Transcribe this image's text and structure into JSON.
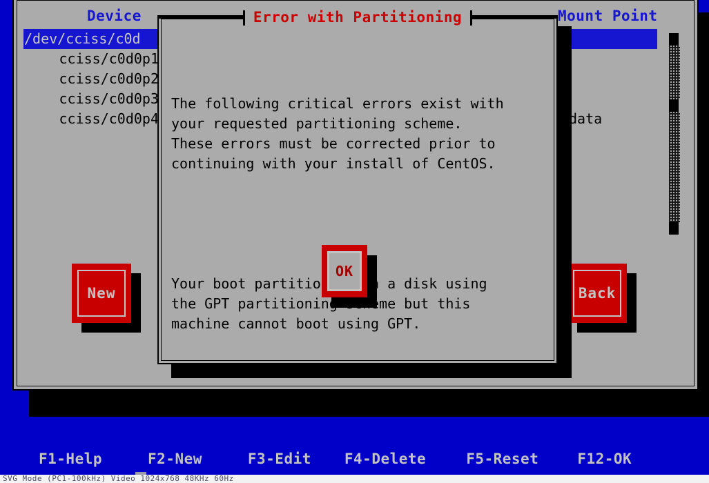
{
  "screen": {
    "background_color": "#0000c8",
    "window_face_color": "#ababab",
    "accent_blue": "#1616d0",
    "button_red": "#c80000",
    "title_red": "#cc0000",
    "label_gray": "#c3c3c3"
  },
  "main_window": {
    "columns": {
      "device_header": "Device",
      "mount_point_header": "Mount Point"
    },
    "devices": [
      {
        "label": "/dev/cciss/c0d",
        "selected": true
      },
      {
        "label": "cciss/c0d0p1",
        "selected": false
      },
      {
        "label": "cciss/c0d0p2",
        "selected": false
      },
      {
        "label": "cciss/c0d0p3",
        "selected": false
      },
      {
        "label": "cciss/c0d0p4",
        "selected": false
      }
    ],
    "mount_points": [
      {
        "label": "",
        "selected": true
      },
      {
        "label": "",
        "selected": false
      },
      {
        "label": "",
        "selected": false
      },
      {
        "label": "",
        "selected": false
      },
      {
        "label": "data",
        "selected": false
      }
    ],
    "buttons": {
      "new_label": "New",
      "back_label": "Back"
    },
    "scrollbar": {
      "up_arrow_icon": "scroll-up-arrow-icon",
      "down_arrow_icon": "scroll-down-arrow-icon",
      "thumb_icon": "scroll-thumb-icon"
    }
  },
  "dialog": {
    "title": "Error with Partitioning",
    "paragraph_1": "The following critical errors exist with\nyour requested partitioning scheme.\nThese errors must be corrected prior to\ncontinuing with your install of CentOS.",
    "paragraph_2": "Your boot partition is on a disk using\nthe GPT partitioning scheme but this\nmachine cannot boot using GPT.",
    "ok_label": "OK"
  },
  "function_bar": {
    "keys": [
      {
        "label": "F1-Help"
      },
      {
        "label": "F2-New"
      },
      {
        "label": "F3-Edit"
      },
      {
        "label": "F4-Delete"
      },
      {
        "label": "F5-Reset"
      },
      {
        "label": "F12-OK"
      }
    ]
  },
  "osd": {
    "text": "SVG Mode (PC1-100kHz) Video  1024x768  48KHz  60Hz"
  }
}
